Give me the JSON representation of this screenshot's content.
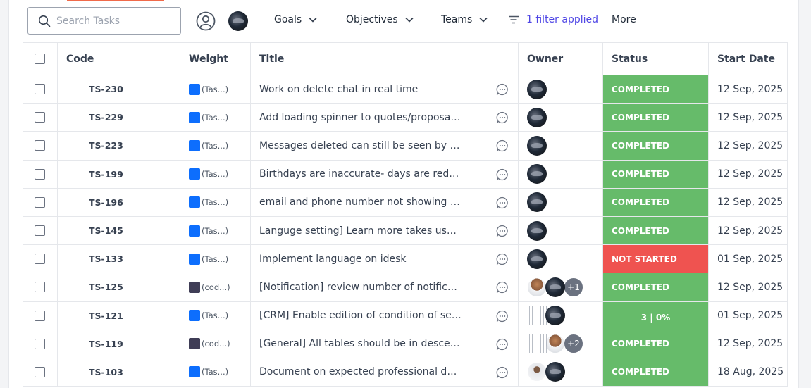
{
  "toolbar": {
    "search_placeholder": "Search Tasks",
    "goals": "Goals",
    "objectives": "Objectives",
    "teams": "Teams",
    "filter_text": "1 filter applied",
    "more": "More"
  },
  "table": {
    "headers": {
      "code": "Code",
      "weight": "Weight",
      "title": "Title",
      "owner": "Owner",
      "status": "Status",
      "start_date": "Start Date"
    },
    "rows": [
      {
        "code": "TS-230",
        "weight": "(Tas...)",
        "weight_color": "#0d6efd",
        "title": "Work on delete chat in real time",
        "owners": [
          "dark"
        ],
        "status": "COMPLETED",
        "start_date": "12 Sep, 2025"
      },
      {
        "code": "TS-229",
        "weight": "(Tas...)",
        "weight_color": "#0d6efd",
        "title": "Add loading spinner to quotes/proposal/i...",
        "owners": [
          "dark"
        ],
        "status": "COMPLETED",
        "start_date": "12 Sep, 2025"
      },
      {
        "code": "TS-223",
        "weight": "(Tas...)",
        "weight_color": "#0d6efd",
        "title": "Messages deleted can still be seen by th...",
        "owners": [
          "dark"
        ],
        "status": "COMPLETED",
        "start_date": "12 Sep, 2025"
      },
      {
        "code": "TS-199",
        "weight": "(Tas...)",
        "weight_color": "#0d6efd",
        "title": "Birthdays are inaccurate- days are redu...",
        "owners": [
          "dark"
        ],
        "status": "COMPLETED",
        "start_date": "12 Sep, 2025"
      },
      {
        "code": "TS-196",
        "weight": "(Tas...)",
        "weight_color": "#0d6efd",
        "title": "email and phone number not showing on...",
        "owners": [
          "dark"
        ],
        "status": "COMPLETED",
        "start_date": "12 Sep, 2025"
      },
      {
        "code": "TS-145",
        "weight": "(Tas...)",
        "weight_color": "#0d6efd",
        "title": "Languge setting] Learn more takes user ...",
        "owners": [
          "dark"
        ],
        "status": "COMPLETED",
        "start_date": "12 Sep, 2025"
      },
      {
        "code": "TS-133",
        "weight": "(Tas...)",
        "weight_color": "#0d6efd",
        "title": "Implement language on idesk",
        "owners": [
          "dark"
        ],
        "status": "NOT STARTED",
        "start_date": "01 Sep, 2025"
      },
      {
        "code": "TS-125",
        "weight": "(cod...)",
        "weight_color": "#3f3d56",
        "title": "[Notification] review number of notificatio...",
        "owners": [
          "photo",
          "dark"
        ],
        "extra": "+1",
        "status": "COMPLETED",
        "start_date": "12 Sep, 2025"
      },
      {
        "code": "TS-121",
        "weight": "(Tas...)",
        "weight_color": "#0d6efd",
        "title": "[CRM] Enable edition of condition of ser...",
        "owners": [
          "dots",
          "dark"
        ],
        "status": "3  |  0%",
        "start_date": "01 Sep, 2025"
      },
      {
        "code": "TS-119",
        "weight": "(cod...)",
        "weight_color": "#3f3d56",
        "title": "[General] All tables should be in descen...",
        "owners": [
          "dots",
          "photo"
        ],
        "extra": "+2",
        "status": "COMPLETED",
        "start_date": "12 Sep, 2025"
      },
      {
        "code": "TS-103",
        "weight": "(Tas...)",
        "weight_color": "#0d6efd",
        "title": "Document on expected professional dev...",
        "owners": [
          "light",
          "dark"
        ],
        "status": "COMPLETED",
        "start_date": "18 Aug, 2025"
      }
    ]
  },
  "colors": {
    "completed": "#66bb6a",
    "not_started": "#ef5350",
    "filter_link": "#4f46e5",
    "accent_top": "#f06a4a"
  }
}
